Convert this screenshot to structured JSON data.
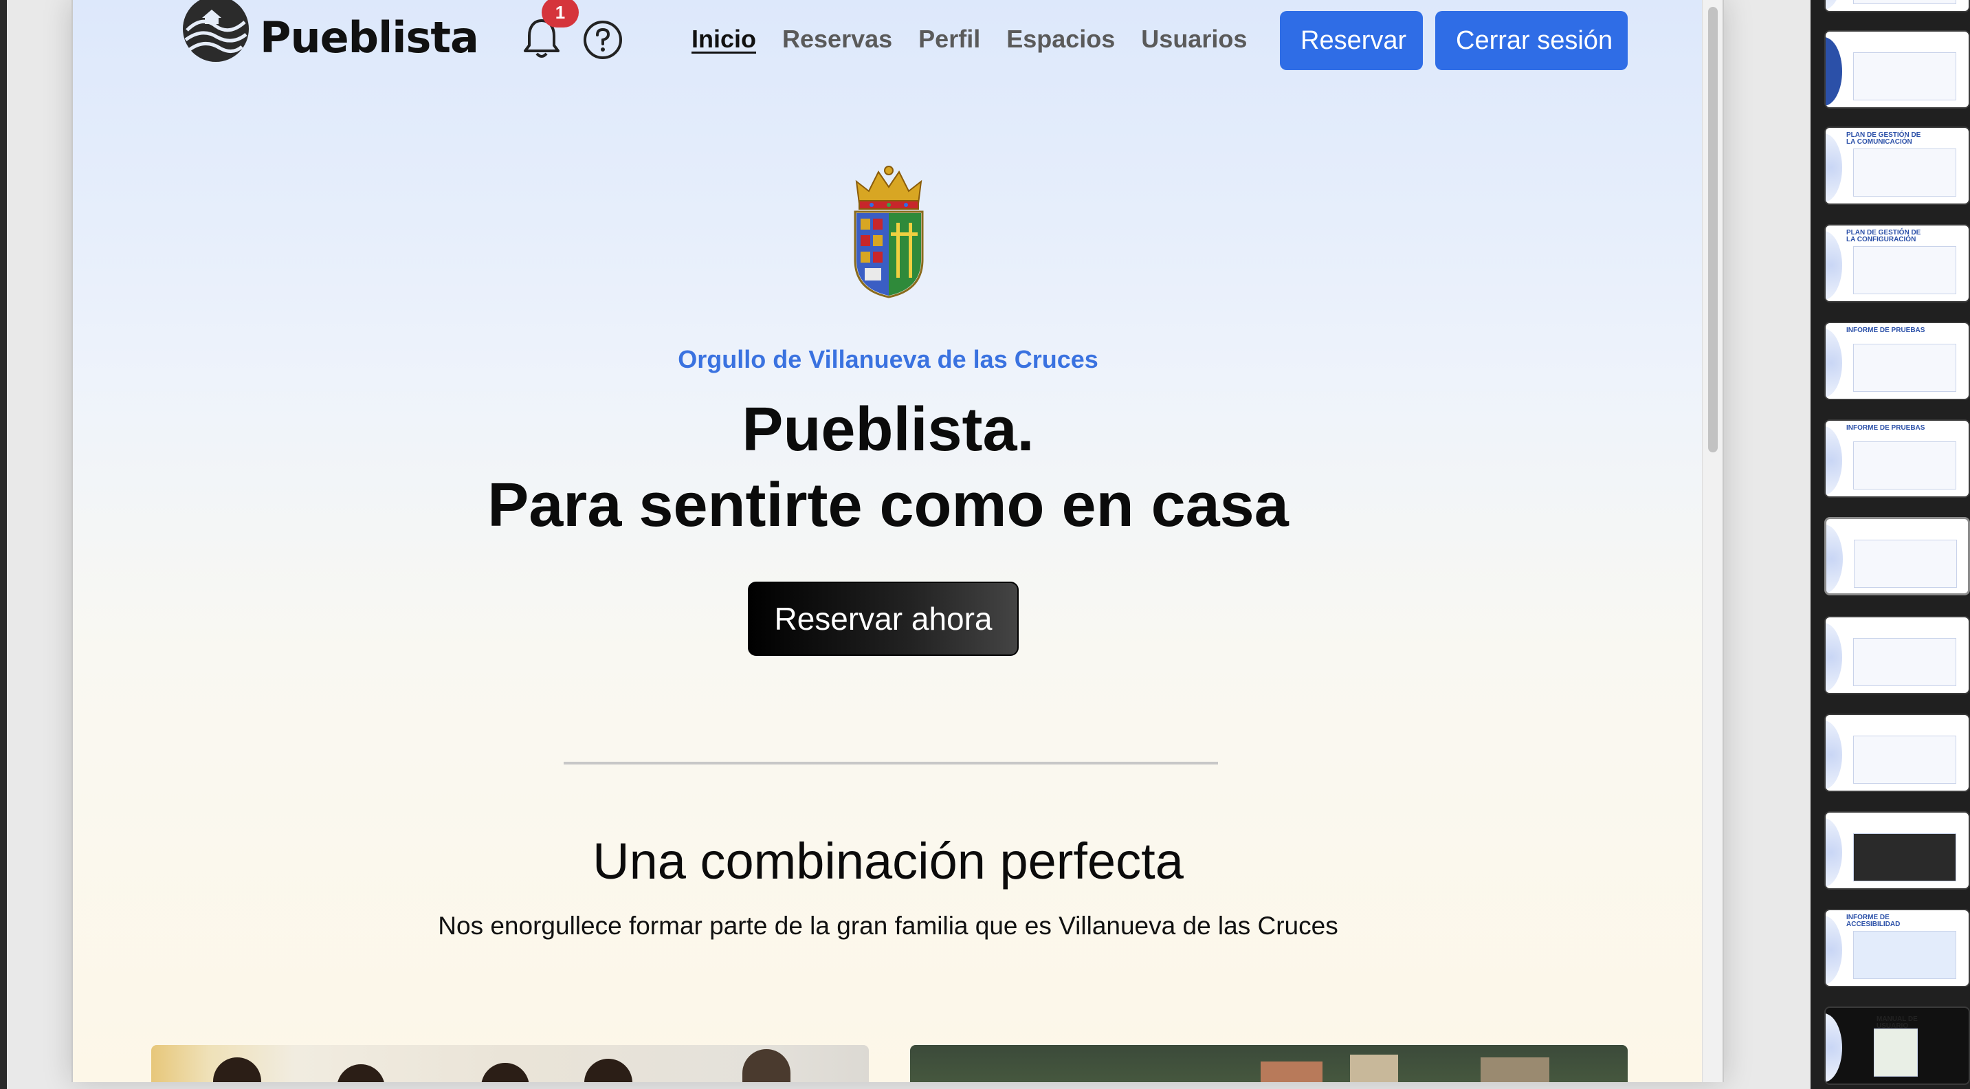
{
  "site": {
    "brand": "Pueblista",
    "notifications_count": "1"
  },
  "nav": {
    "items": [
      {
        "label": "Inicio",
        "active": true
      },
      {
        "label": "Reservas",
        "active": false
      },
      {
        "label": "Perfil",
        "active": false
      },
      {
        "label": "Espacios",
        "active": false
      },
      {
        "label": "Usuarios",
        "active": false
      }
    ],
    "reserve_label": "Reservar",
    "logout_label": "Cerrar sesión"
  },
  "hero": {
    "eyebrow": "Orgullo de Villanueva de las Cruces",
    "title_line1": "Pueblista.",
    "title_line2": "Para sentirte como en casa",
    "cta_label": "Reservar ahora"
  },
  "section": {
    "title": "Una combinación perfecta",
    "subtitle": "Nos enorgullece formar parte de la gran familia que es Villanueva de las Cruces"
  },
  "sidebar_thumbnails": [
    {
      "title": "",
      "icon": "slide-thumb"
    },
    {
      "title": "",
      "icon": "slide-thumb"
    },
    {
      "title": "PLAN DE GESTIÓN DE LA COMUNICACIÓN",
      "icon": "slide-thumb"
    },
    {
      "title": "PLAN DE GESTIÓN DE LA CONFIGURACIÓN",
      "icon": "slide-thumb"
    },
    {
      "title": "INFORME DE PRUEBAS",
      "icon": "slide-thumb"
    },
    {
      "title": "INFORME DE PRUEBAS",
      "icon": "slide-thumb"
    },
    {
      "title": "",
      "icon": "slide-thumb",
      "selected": true
    },
    {
      "title": "",
      "icon": "slide-thumb"
    },
    {
      "title": "",
      "icon": "slide-thumb"
    },
    {
      "title": "",
      "icon": "slide-thumb"
    },
    {
      "title": "INFORME DE ACCESIBILIDAD",
      "icon": "slide-thumb"
    },
    {
      "title": "MANUAL DE USUARIO",
      "icon": "slide-thumb"
    }
  ],
  "colors": {
    "primary": "#2f6de6",
    "accent_text": "#3a72e0",
    "badge": "#d5343b"
  }
}
